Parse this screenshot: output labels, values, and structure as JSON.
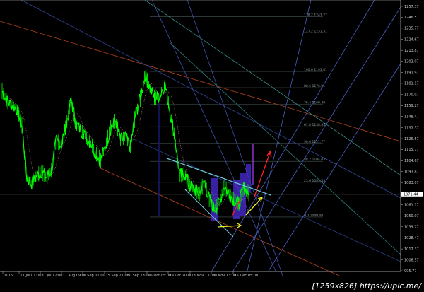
{
  "chart_data": {
    "type": "line",
    "ylim": [
      995.77,
      1257.37
    ],
    "price_axis_ticks": [
      "1257.37",
      "1246.57",
      "1235.77",
      "1224.67",
      "1213.87",
      "1203.07",
      "1191.97",
      "1181.17",
      "1170.07",
      "1159.27",
      "1148.47",
      "1137.37",
      "1126.57",
      "1115.77",
      "1104.67",
      "1093.87",
      "1083.07",
      "1061.17",
      "1050.07",
      "1039.27",
      "1028.47",
      "1017.37",
      "1006.57",
      "995.77"
    ],
    "current_price": "1071.44",
    "time_axis_ticks": [
      "2015",
      "17 Jul 01:00",
      "31 Jul 17:00",
      "17 Aug 09:00",
      "1 Sep 01:00",
      "15 Sep 21:00",
      "30 Sep 13:00",
      "15 Oct 05:00",
      "29 Oct 20:00",
      "13 Nov 13:00",
      "30 Nov 13:00",
      "15 Dec 05:00"
    ],
    "price_series": [
      1173.6,
      1163,
      1160,
      1156,
      1140,
      1088,
      1082,
      1090,
      1094,
      1088,
      1095,
      1125,
      1120,
      1140,
      1165,
      1140,
      1135,
      1128,
      1122,
      1112,
      1105,
      1120,
      1137,
      1145,
      1125,
      1128,
      1118,
      1150,
      1166,
      1190,
      1176,
      1166,
      1170,
      1181,
      1155,
      1128,
      1090,
      1092,
      1080,
      1076,
      1072,
      1084,
      1066,
      1057,
      1062,
      1080,
      1072,
      1066,
      1062,
      1078,
      1073
    ],
    "fibonacci_levels": [
      {
        "level": "138.2",
        "price": "1247.27"
      },
      {
        "level": "127.2",
        "price": "1231.31"
      },
      {
        "level": "100.0",
        "price": "1193.01"
      },
      {
        "level": "88.6",
        "price": "1176.91"
      },
      {
        "level": "76.4",
        "price": "1160.40"
      },
      {
        "level": "61.8",
        "price": "1138.35"
      },
      {
        "level": "50.0",
        "price": "1121.77"
      },
      {
        "level": "38.2",
        "price": "1104.03"
      },
      {
        "level": "23.6",
        "price": "1083.35"
      },
      {
        "level": "0.0",
        "price": "1049.00"
      }
    ],
    "colors": {
      "price": "#00ff00",
      "background": "#000000",
      "channel": "#c0461e",
      "trend": "#3a4fa8",
      "wedge": "#6fd0e0",
      "arrow_up": "#ff2020",
      "arrow_yellow": "#f0f020",
      "histogram": "#5a3cff"
    }
  },
  "watermark": "[1259x826] https://upic.me/"
}
